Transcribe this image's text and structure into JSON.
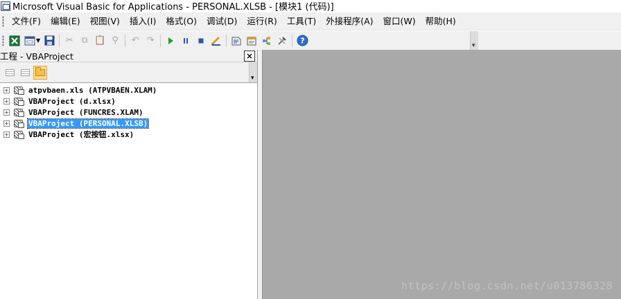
{
  "window": {
    "title": "Microsoft Visual Basic for Applications - PERSONAL.XLSB - [模块1 (代码)]"
  },
  "menubar": {
    "items": [
      "文件(F)",
      "编辑(E)",
      "视图(V)",
      "插入(I)",
      "格式(O)",
      "调试(D)",
      "运行(R)",
      "工具(T)",
      "外接程序(A)",
      "窗口(W)",
      "帮助(H)"
    ]
  },
  "toolbar": {
    "icons": [
      "excel-icon",
      "insert-userform-icon",
      "save-icon",
      "cut-icon",
      "copy-icon",
      "paste-icon",
      "find-icon",
      "undo-icon",
      "redo-icon",
      "run-icon",
      "break-icon",
      "reset-icon",
      "design-mode-icon",
      "project-explorer-icon",
      "properties-icon",
      "object-browser-icon",
      "toolbox-icon",
      "help-icon"
    ]
  },
  "project_panel": {
    "title": "工程 - VBAProject",
    "close_label": "×",
    "tree": [
      {
        "label": "atpvbaen.xls (ATPVBAEN.XLAM)",
        "selected": false
      },
      {
        "label": "VBAProject (d.xlsx)",
        "selected": false
      },
      {
        "label": "VBAProject (FUNCRES.XLAM)",
        "selected": false
      },
      {
        "label": "VBAProject (PERSONAL.XLSB)",
        "selected": true
      },
      {
        "label": "VBAProject (宏按钮.xlsx)",
        "selected": false
      }
    ],
    "expander_symbol": "+"
  },
  "watermark": {
    "text": "https://blog.csdn.net/u013786328"
  },
  "colors": {
    "selection": "#3399ff",
    "code_background": "#a9a9a9",
    "chrome": "#f0f0f0"
  }
}
